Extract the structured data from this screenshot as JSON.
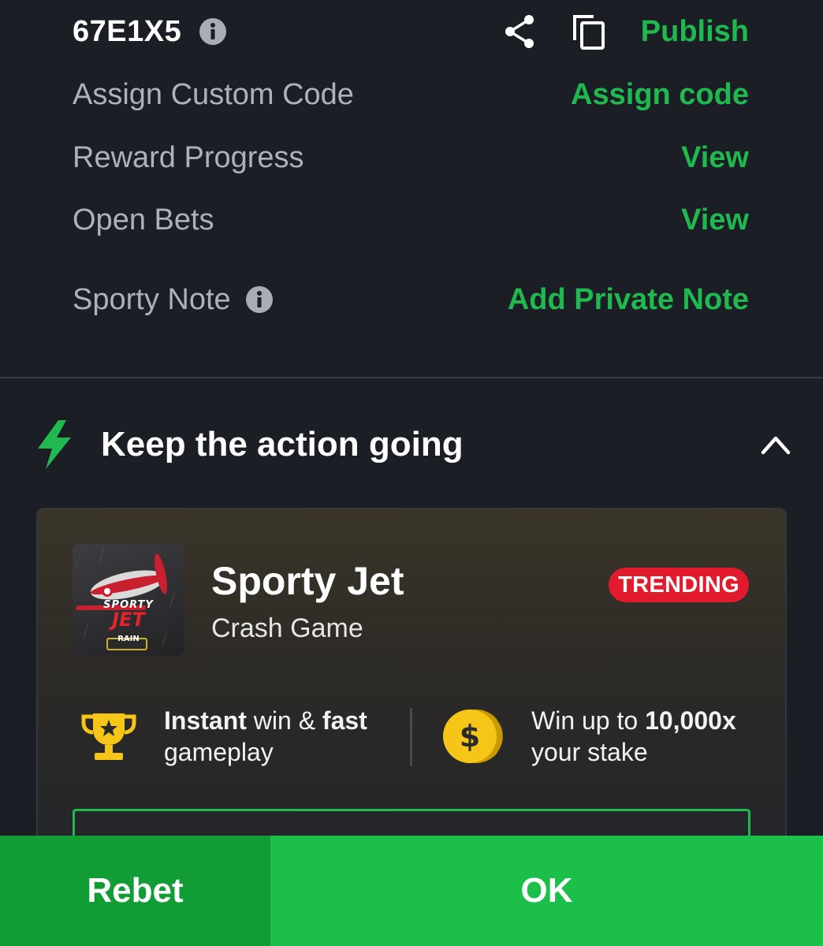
{
  "booking": {
    "code": "67E1X5",
    "publish_label": "Publish"
  },
  "rows": {
    "assign": {
      "label": "Assign Custom Code",
      "action": "Assign code"
    },
    "reward": {
      "label": "Reward Progress",
      "action": "View"
    },
    "open_bets": {
      "label": "Open Bets",
      "action": "View"
    },
    "note": {
      "label": "Sporty Note",
      "action": "Add Private Note"
    }
  },
  "section": {
    "title": "Keep the action going"
  },
  "game": {
    "title": "Sporty Jet",
    "subtitle": "Crash Game",
    "badge": "TRENDING",
    "thumb_logo_line1": "SPORTY",
    "thumb_logo_line2": "JET",
    "thumb_logo_tag": "RAIN",
    "feature1": {
      "bold1": "Instant",
      "mid": " win & ",
      "bold2": "fast",
      "line2": "gameplay"
    },
    "feature2": {
      "pre": "Win up to ",
      "bold": "10,000x",
      "line2": "your stake"
    }
  },
  "buttons": {
    "rebet": "Rebet",
    "ok": "OK"
  },
  "colors": {
    "accent_green": "#1fb94f",
    "badge_red": "#e11b2d",
    "background": "#1b1e25",
    "trophy_yellow": "#f5c518"
  },
  "icons": [
    "info-icon",
    "share-icon",
    "copy-icon",
    "lightning-icon",
    "chevron-up-icon",
    "trophy-icon",
    "coin-icon"
  ]
}
